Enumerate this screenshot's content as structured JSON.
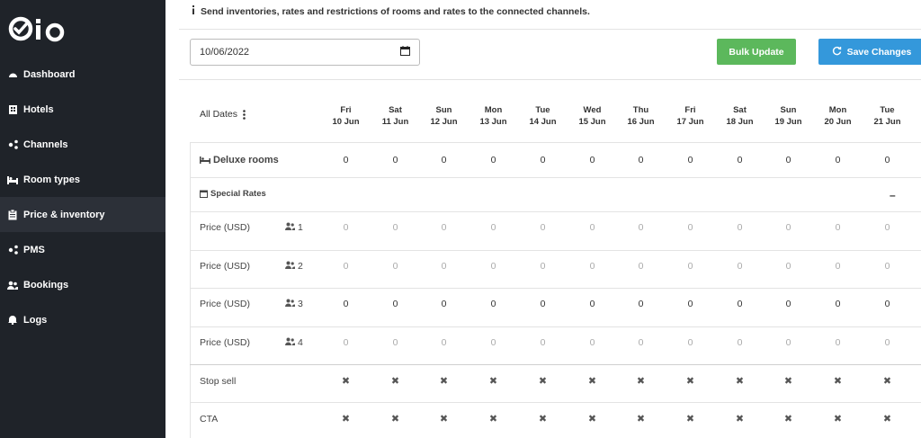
{
  "logo_text": "Qio",
  "nav": [
    {
      "label": "Dashboard",
      "icon": "dashboard-icon"
    },
    {
      "label": "Hotels",
      "icon": "building-icon"
    },
    {
      "label": "Channels",
      "icon": "share-icon"
    },
    {
      "label": "Room types",
      "icon": "bed-icon"
    },
    {
      "label": "Price & inventory",
      "icon": "clipboard-icon"
    },
    {
      "label": "PMS",
      "icon": "share-icon"
    },
    {
      "label": "Bookings",
      "icon": "users-icon"
    },
    {
      "label": "Logs",
      "icon": "bell-icon"
    }
  ],
  "info_text": "Send inventories, rates and restrictions of rooms and rates to the connected channels.",
  "date_value": "10/06/2022",
  "buttons": {
    "bulk": "Bulk Update",
    "save": "Save Changes"
  },
  "all_dates_label": "All Dates",
  "dates": [
    {
      "day": "Fri",
      "date": "10 Jun"
    },
    {
      "day": "Sat",
      "date": "11 Jun"
    },
    {
      "day": "Sun",
      "date": "12 Jun"
    },
    {
      "day": "Mon",
      "date": "13 Jun"
    },
    {
      "day": "Tue",
      "date": "14 Jun"
    },
    {
      "day": "Wed",
      "date": "15 Jun"
    },
    {
      "day": "Thu",
      "date": "16 Jun"
    },
    {
      "day": "Fri",
      "date": "17 Jun"
    },
    {
      "day": "Sat",
      "date": "18 Jun"
    },
    {
      "day": "Sun",
      "date": "19 Jun"
    },
    {
      "day": "Mon",
      "date": "20 Jun"
    },
    {
      "day": "Tue",
      "date": "21 Jun"
    }
  ],
  "room": {
    "label": "Deluxe rooms",
    "values": [
      "0",
      "0",
      "0",
      "0",
      "0",
      "0",
      "0",
      "0",
      "0",
      "0",
      "0",
      "0"
    ]
  },
  "rate_section": {
    "label": "Special Rates",
    "collapse": "–"
  },
  "prices": [
    {
      "label": "Price (USD)",
      "occupancy": "1",
      "values": [
        "0",
        "0",
        "0",
        "0",
        "0",
        "0",
        "0",
        "0",
        "0",
        "0",
        "0",
        "0"
      ],
      "dim": true
    },
    {
      "label": "Price (USD)",
      "occupancy": "2",
      "values": [
        "0",
        "0",
        "0",
        "0",
        "0",
        "0",
        "0",
        "0",
        "0",
        "0",
        "0",
        "0"
      ],
      "dim": true
    },
    {
      "label": "Price (USD)",
      "occupancy": "3",
      "values": [
        "0",
        "0",
        "0",
        "0",
        "0",
        "0",
        "0",
        "0",
        "0",
        "0",
        "0",
        "0"
      ],
      "dim": false
    },
    {
      "label": "Price (USD)",
      "occupancy": "4",
      "values": [
        "0",
        "0",
        "0",
        "0",
        "0",
        "0",
        "0",
        "0",
        "0",
        "0",
        "0",
        "0"
      ],
      "dim": true
    }
  ],
  "restrictions": [
    {
      "label": "Stop sell",
      "values": [
        "✖",
        "✖",
        "✖",
        "✖",
        "✖",
        "✖",
        "✖",
        "✖",
        "✖",
        "✖",
        "✖",
        "✖"
      ]
    },
    {
      "label": "CTA",
      "values": [
        "✖",
        "✖",
        "✖",
        "✖",
        "✖",
        "✖",
        "✖",
        "✖",
        "✖",
        "✖",
        "✖",
        "✖"
      ]
    }
  ]
}
